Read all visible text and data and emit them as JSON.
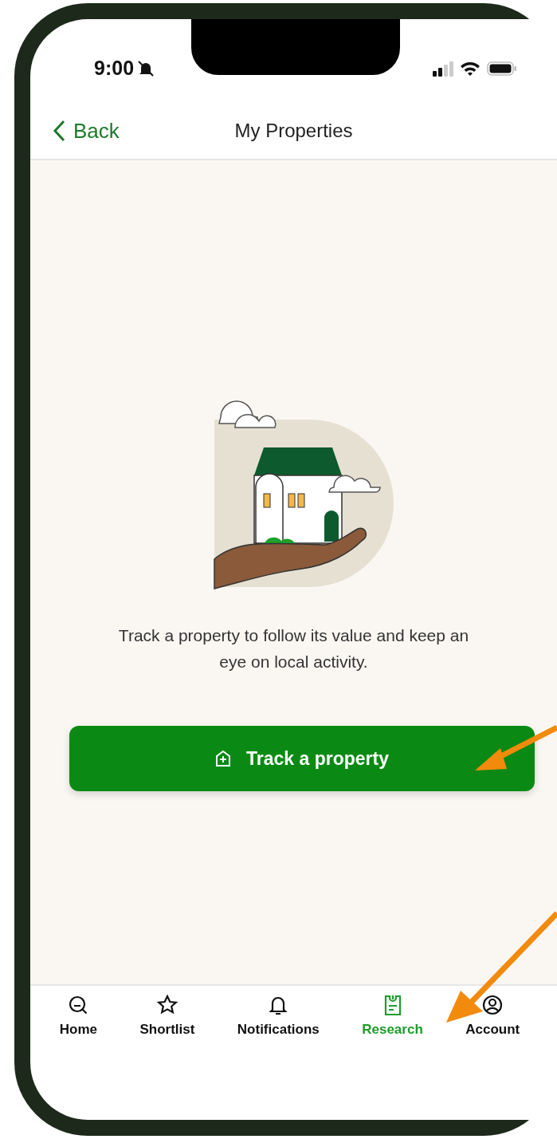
{
  "status_bar": {
    "time": "9:00",
    "silent": true
  },
  "header": {
    "back": "Back",
    "title": "My Properties"
  },
  "empty_state": {
    "message": "Track a property to follow its value and keep an eye on local activity.",
    "button": "Track a property"
  },
  "tabs": [
    {
      "label": "Home",
      "selected": false
    },
    {
      "label": "Shortlist",
      "selected": false
    },
    {
      "label": "Notifications",
      "selected": false
    },
    {
      "label": "Research",
      "selected": true
    },
    {
      "label": "Account",
      "selected": false
    }
  ]
}
